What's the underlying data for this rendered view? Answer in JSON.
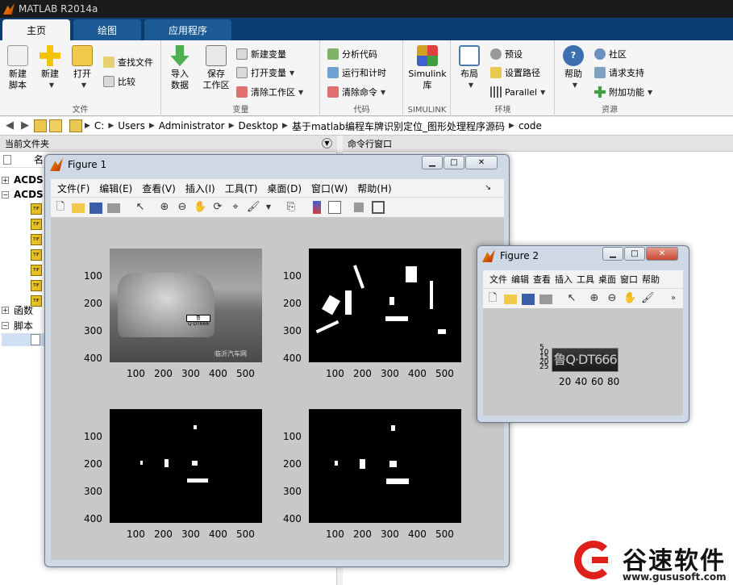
{
  "app": {
    "title": "MATLAB R2014a"
  },
  "tabs": [
    "主页",
    "绘图",
    "应用程序"
  ],
  "ribbon": {
    "file": {
      "label": "文件",
      "new_script": "新建\n脚本",
      "new": "新建",
      "open": "打开",
      "find_files": "查找文件",
      "compare": "比较"
    },
    "variable": {
      "label": "变量",
      "import": "导入\n数据",
      "save_ws": "保存\n工作区",
      "new_var": "新建变量",
      "open_var": "打开变量",
      "clear_ws": "清除工作区"
    },
    "code": {
      "label": "代码",
      "analyze": "分析代码",
      "run_time": "运行和计时",
      "clear_cmd": "清除命令"
    },
    "simulink": {
      "label": "SIMULINK",
      "lib": "Simulink\n库"
    },
    "env": {
      "label": "环境",
      "layout": "布局",
      "prefs": "预设",
      "set_path": "设置路径",
      "parallel": "Parallel"
    },
    "resources": {
      "label": "资源",
      "help": "帮助",
      "community": "社区",
      "support": "请求支持",
      "addons": "附加功能"
    }
  },
  "address": {
    "segments": [
      "C:",
      "Users",
      "Administrator",
      "Desktop",
      "基于matlab编程车牌识别定位_图形处理程序源码",
      "code"
    ]
  },
  "panels": {
    "current_folder": "当前文件夹",
    "command_window": "命令行窗口",
    "name_col": "名"
  },
  "tree": {
    "item1": "ACDS",
    "item2": "ACDS",
    "funcs": "函数",
    "scripts": "脚本"
  },
  "figure1": {
    "title": "Figure 1",
    "menu": [
      "文件(F)",
      "编辑(E)",
      "查看(V)",
      "插入(I)",
      "工具(T)",
      "桌面(D)",
      "窗口(W)",
      "帮助(H)"
    ],
    "yticks": [
      "100",
      "200",
      "300",
      "400"
    ],
    "xticks": [
      "100",
      "200",
      "300",
      "400",
      "500"
    ],
    "photo_plate": "鲁Q·DT666",
    "watermark": "临沂汽车网"
  },
  "figure2": {
    "title": "Figure 2",
    "menu": [
      "文件",
      "编辑",
      "查看",
      "插入",
      "工具",
      "桌面",
      "窗口",
      "帮助"
    ],
    "yticks": [
      "5",
      "10",
      "15",
      "20",
      "25"
    ],
    "xticks": [
      "20",
      "40",
      "60",
      "80"
    ],
    "plate_text": "鲁Q·DT666"
  },
  "brand": {
    "name": "谷速软件",
    "url": "www.gususoft.com"
  },
  "colors": {
    "accent": "#0b3c70",
    "brand_red": "#e0201b"
  }
}
